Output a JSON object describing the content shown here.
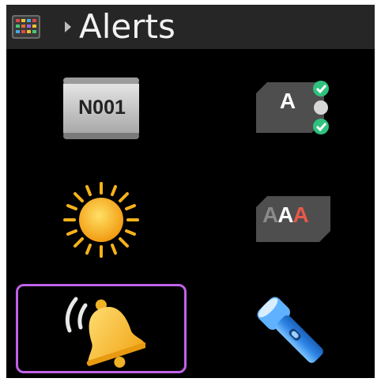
{
  "header": {
    "title": "Alerts",
    "menu_icon": "app-grid-icon",
    "chevron_icon": "chevron-right-icon"
  },
  "tiles": [
    {
      "id": "notification-code",
      "icon": "id-badge-icon",
      "text": "N001"
    },
    {
      "id": "reply-options",
      "icon": "text-options-icon",
      "text": "A"
    },
    {
      "id": "brightness",
      "icon": "sun-icon"
    },
    {
      "id": "font-size",
      "icon": "font-size-icon",
      "text": "AAA"
    },
    {
      "id": "vibrate-alert",
      "icon": "bell-icon",
      "selected": true
    },
    {
      "id": "flashlight",
      "icon": "flashlight-icon"
    }
  ],
  "colors": {
    "background": "#000000",
    "header": "#262626",
    "selection": "#c062e8",
    "check": "#2ec27e",
    "sun": "#f6b21a",
    "bell": "#f7c531",
    "flashlight": "#3a8fe8",
    "font_accent": "#e8584a"
  }
}
